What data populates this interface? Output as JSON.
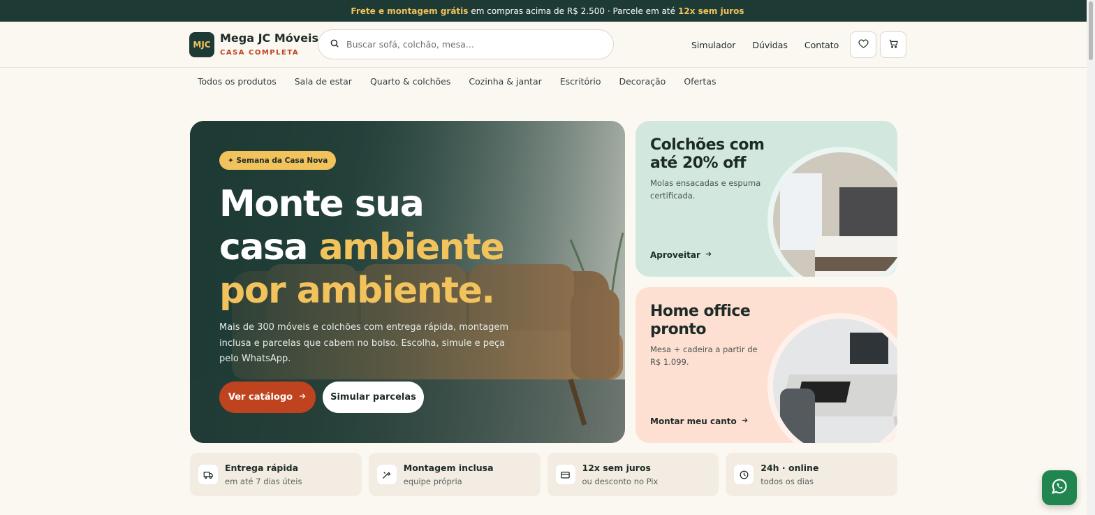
{
  "topbar": {
    "hl1": "Frete e montagem grátis",
    "text1": "em compras acima de R$ 2.500 · Parcele em até",
    "hl2": "12x sem juros"
  },
  "header": {
    "logo": "MJC",
    "brand_name": "Mega JC Móveis",
    "brand_sub": "CASA COMPLETA",
    "search_placeholder": "Buscar sofá, colchão, mesa...",
    "links": [
      "Simulador",
      "Dúvidas",
      "Contato"
    ]
  },
  "categories": [
    "Todos os produtos",
    "Sala de estar",
    "Quarto & colchões",
    "Cozinha & jantar",
    "Escritório",
    "Decoração",
    "Ofertas"
  ],
  "hero": {
    "badge": "✦ Semana da Casa Nova",
    "title_line1": "Monte sua",
    "title_line2a": "casa ",
    "title_line2b": "ambiente",
    "title_line3": "por ambiente.",
    "text": "Mais de 300 móveis e colchões com entrega rápida, montagem inclusa e parcelas que cabem no bolso. Escolha, simule e peça pelo WhatsApp.",
    "primary_btn": "Ver catálogo",
    "secondary_btn": "Simular parcelas"
  },
  "promos": [
    {
      "title": "Colchões com até 20% off",
      "text": "Molas ensacadas e espuma certificada.",
      "cta": "Aproveitar"
    },
    {
      "title": "Home office pronto",
      "text": "Mesa + cadeira a partir de R$ 1.099.",
      "cta": "Montar meu canto"
    }
  ],
  "features": [
    {
      "title": "Entrega rápida",
      "sub": "em até 7 dias úteis",
      "icon": "truck-icon"
    },
    {
      "title": "Montagem inclusa",
      "sub": "equipe própria",
      "icon": "tools-icon"
    },
    {
      "title": "12x sem juros",
      "sub": "ou desconto no Pix",
      "icon": "card-icon"
    },
    {
      "title": "24h · online",
      "sub": "todos os dias",
      "icon": "clock-icon"
    }
  ],
  "colors": {
    "primary": "#1e3a34",
    "accent": "#f2c25c",
    "cta": "#c0431f",
    "whatsapp": "#20854f"
  }
}
